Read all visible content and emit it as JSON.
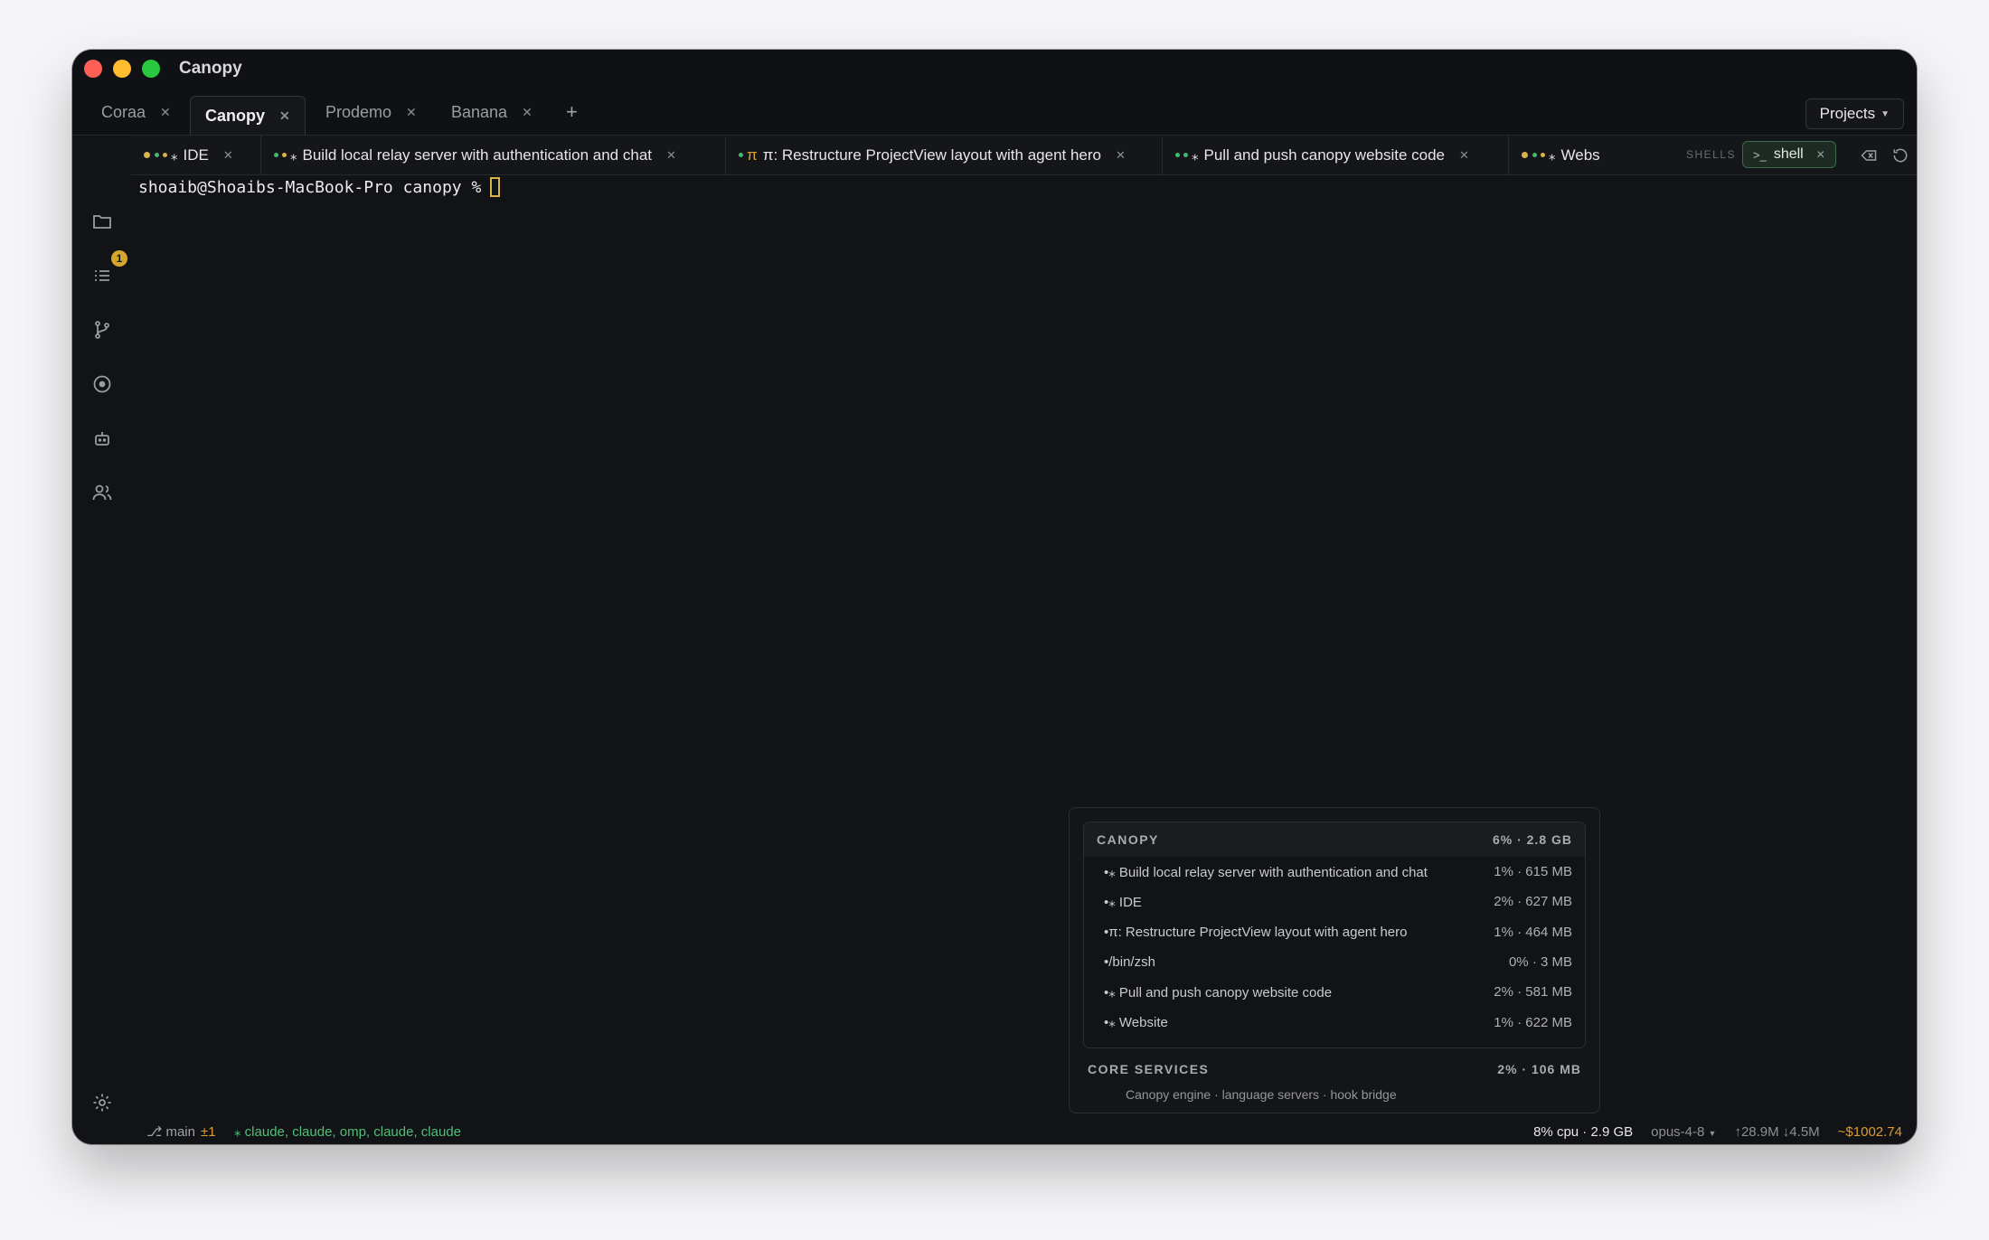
{
  "window": {
    "title": "Canopy"
  },
  "project_tabs": [
    {
      "label": "Coraa",
      "active": false
    },
    {
      "label": "Canopy",
      "active": true
    },
    {
      "label": "Prodemo",
      "active": false
    },
    {
      "label": "Banana",
      "active": false
    }
  ],
  "projects_button": "Projects",
  "sidebar": {
    "icons": [
      "folder-icon",
      "task-list-icon",
      "git-branch-icon",
      "record-icon",
      "bot-icon",
      "users-icon",
      "gear-icon",
      "panel-toggle-icon"
    ],
    "task_badge": "1"
  },
  "session_tabs": [
    {
      "label": "IDE"
    },
    {
      "label": "Build local relay server with authentication and chat"
    },
    {
      "label": "π: Restructure ProjectView layout with agent hero"
    },
    {
      "label": "Pull and push canopy website code"
    },
    {
      "label": "Webs"
    }
  ],
  "shells": {
    "label": "SHELLS",
    "active_shell": "shell",
    "prompt_glyph": ">_"
  },
  "terminal": {
    "prompt": "shoaib@Shoaibs-MacBook-Pro canopy %"
  },
  "resource_popover": {
    "group_title": "CANOPY",
    "group_stat": "6% · 2.8 GB",
    "processes": [
      {
        "name": "•⁎ Build local relay server with authentication and chat",
        "stat": "1% · 615 MB"
      },
      {
        "name": "•⁎ IDE",
        "stat": "2% · 627 MB"
      },
      {
        "name": "•π: Restructure ProjectView layout with agent hero",
        "stat": "1% · 464 MB"
      },
      {
        "name": "•/bin/zsh",
        "stat": "0% · 3 MB"
      },
      {
        "name": "•⁎ Pull and push canopy website code",
        "stat": "2% · 581 MB"
      },
      {
        "name": "•⁎ Website",
        "stat": "1% · 622 MB"
      }
    ],
    "core_title": "CORE SERVICES",
    "core_stat": "2% · 106 MB",
    "core_desc": "Canopy engine · language servers · hook bridge"
  },
  "statusbar": {
    "branch": "main",
    "diff": "±1",
    "agents": "claude, claude, omp, claude, claude",
    "cpu": "8% cpu · 2.9 GB",
    "model": "opus-4-8",
    "network": "↑28.9M ↓4.5M",
    "cost": "~$1002.74"
  },
  "colors": {
    "accent_green": "#3fb970",
    "accent_yellow": "#d9b24a",
    "cost_orange": "#e09a2a"
  }
}
